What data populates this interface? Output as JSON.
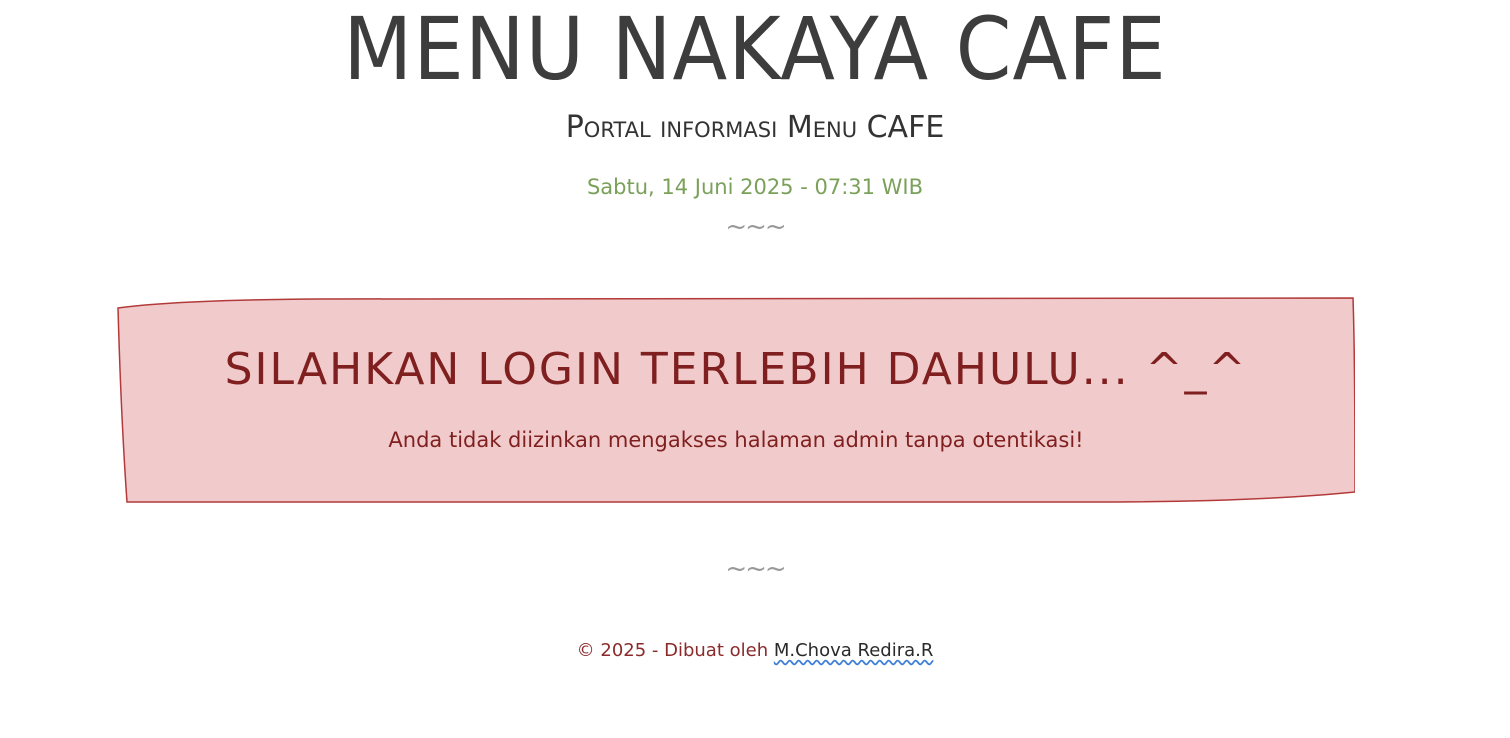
{
  "header": {
    "title": "MENU NAKAYA CAFE",
    "subtitle": "Portal informasi Menu CAFE",
    "datetime": "Sabtu, 14 Juni 2025 - 07:31 WIB",
    "divider": "~~~"
  },
  "alert": {
    "heading": "SILAHKAN LOGIN TERLEBIH DAHULU... ^_^",
    "message": "Anda tidak diizinkan mengakses halaman admin tanpa otentikasi!",
    "background_color": "#f1cbcb",
    "border_color": "#b23a3a",
    "text_color": "#7f1f1f"
  },
  "divider_bottom": "~~~",
  "footer": {
    "prefix": "© 2025 - Dibuat oleh ",
    "author_link": "M.Chova Redira.R"
  },
  "colors": {
    "title": "#3d3d3d",
    "datetime": "#7aa05a",
    "divider": "#999999",
    "footer_text": "#8a2a2a"
  }
}
